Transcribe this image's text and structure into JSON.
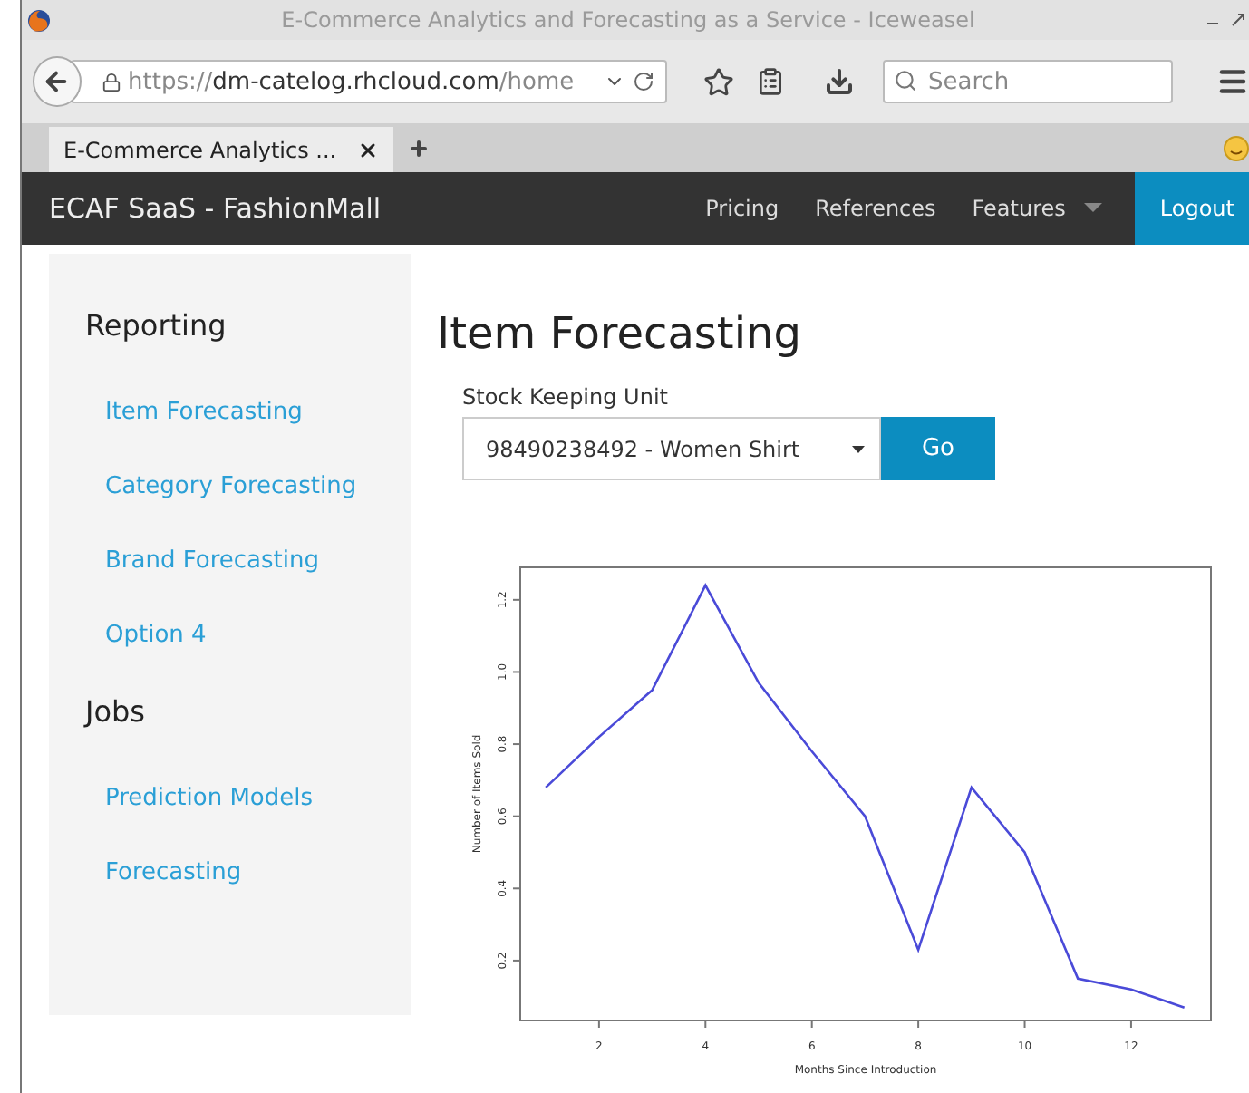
{
  "window": {
    "title": "E-Commerce Analytics and Forecasting as a Service - Iceweasel"
  },
  "toolbar": {
    "url": {
      "scheme": "https://",
      "host": "dm-catelog.rhcloud.com",
      "path": "/home"
    },
    "search": {
      "placeholder": "Search"
    }
  },
  "tabs": [
    {
      "label": "E-Commerce Analytics ...",
      "selected": true
    }
  ],
  "navbar": {
    "brand": "ECAF SaaS - FashionMall",
    "items": [
      {
        "label": "Pricing",
        "kind": "link"
      },
      {
        "label": "References",
        "kind": "link"
      },
      {
        "label": "Features",
        "kind": "dropdown"
      }
    ],
    "logout": "Logout"
  },
  "sidebar": {
    "sections": [
      {
        "heading": "Reporting",
        "items": [
          {
            "label": "Item Forecasting"
          },
          {
            "label": "Category Forecasting"
          },
          {
            "label": "Brand Forecasting"
          },
          {
            "label": "Option 4"
          }
        ]
      },
      {
        "heading": "Jobs",
        "items": [
          {
            "label": "Prediction Models"
          },
          {
            "label": "Forecasting"
          }
        ]
      }
    ]
  },
  "main": {
    "title": "Item Forecasting",
    "sku_label": "Stock Keeping Unit",
    "sku_value": "98490238492 - Women Shirt",
    "button": "Go",
    "chart_data": {
      "type": "line",
      "xlabel": "Months Since Introduction",
      "ylabel": "Number of Items Sold",
      "x": [
        1,
        2,
        3,
        4,
        5,
        6,
        7,
        8,
        9,
        10,
        11,
        12,
        13
      ],
      "series": [
        {
          "color": "#4a4ad8",
          "values": [
            0.68,
            0.82,
            0.95,
            1.24,
            0.97,
            0.78,
            0.6,
            0.23,
            0.68,
            0.5,
            0.15,
            0.12,
            0.07
          ]
        }
      ],
      "xlim": [
        0.52,
        13.5
      ],
      "ylim": [
        0.034,
        1.29
      ],
      "xticks": [
        2,
        4,
        6,
        8,
        10,
        12
      ],
      "yticks": [
        0.2,
        0.4,
        0.6,
        0.8,
        {
          "value": 1,
          "label": "1.0"
        },
        1.2
      ]
    }
  }
}
